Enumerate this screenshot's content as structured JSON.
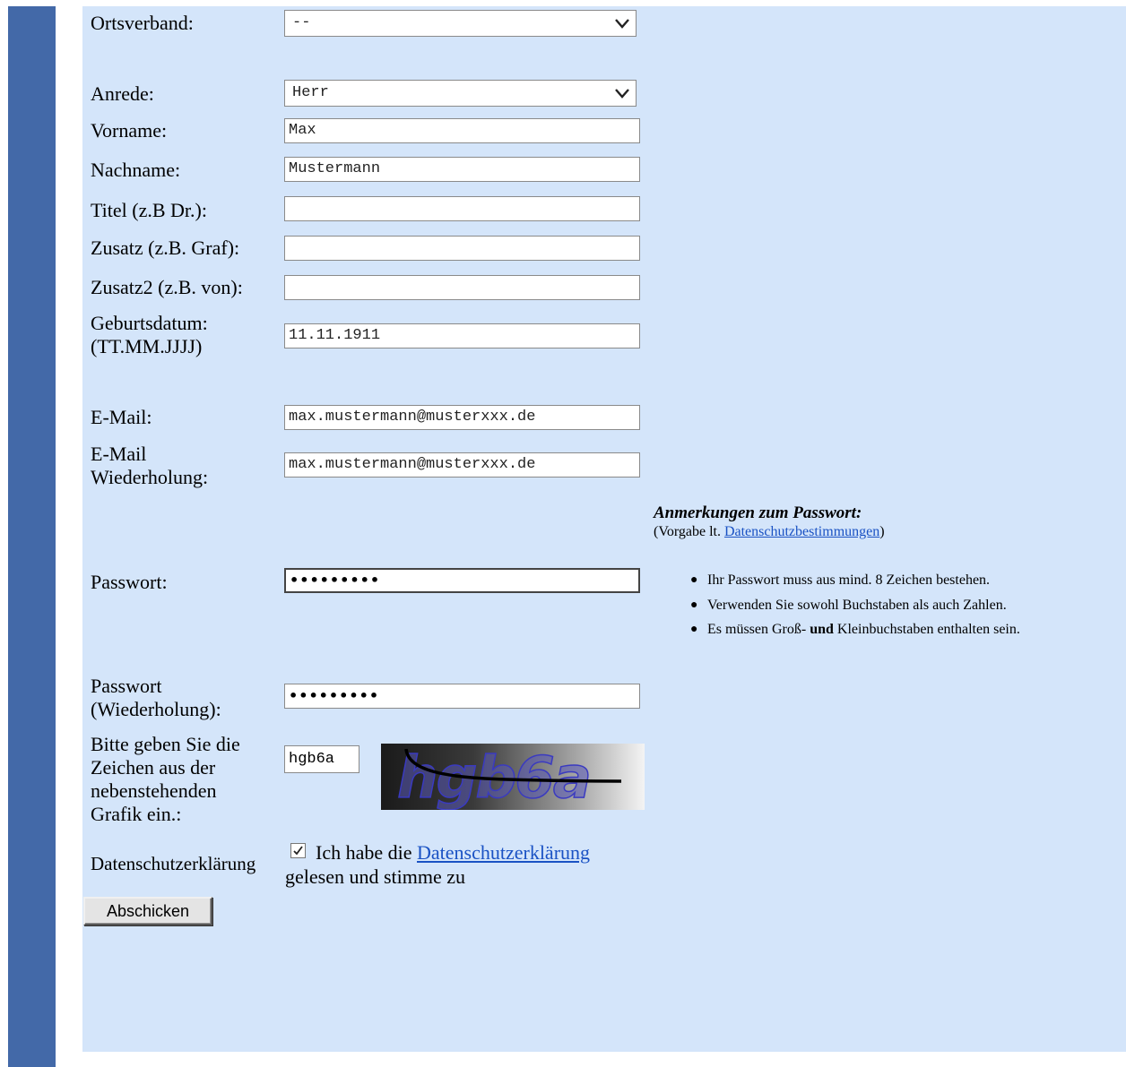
{
  "form": {
    "ortsverband": {
      "label": "Ortsverband:",
      "value": "--"
    },
    "anrede": {
      "label": "Anrede:",
      "value": "Herr"
    },
    "vorname": {
      "label": "Vorname:",
      "value": "Max"
    },
    "nachname": {
      "label": "Nachname:",
      "value": "Mustermann"
    },
    "titel": {
      "label": "Titel (z.B Dr.):",
      "value": ""
    },
    "zusatz": {
      "label": "Zusatz (z.B. Graf):",
      "value": ""
    },
    "zusatz2": {
      "label": "Zusatz2 (z.B. von):",
      "value": ""
    },
    "geburtsdatum": {
      "label_line1": "Geburtsdatum:",
      "label_line2": "(TT.MM.JJJJ)",
      "value": "11.11.1911"
    },
    "email": {
      "label": "E-Mail:",
      "value": "max.mustermann@musterxxx.de"
    },
    "email_repeat": {
      "label_line1": "E-Mail",
      "label_line2": "Wiederholung:",
      "value": "max.mustermann@musterxxx.de"
    },
    "passwort": {
      "label": "Passwort:",
      "masked_value": "•••••••••"
    },
    "passwort_repeat": {
      "label_line1": "Passwort",
      "label_line2": "(Wiederholung):",
      "masked_value": "•••••••••"
    },
    "captcha": {
      "label_lines": [
        "Bitte geben Sie die",
        "Zeichen aus der",
        "nebenstehenden",
        "Grafik ein.:"
      ],
      "value": "hgb6a",
      "image_text": "hgb6a"
    },
    "datenschutz": {
      "label": "Datenschutzerklärung",
      "checked": true,
      "text_before": "Ich habe die",
      "link_text": "Datenschutzerklärung",
      "text_after": "gelesen und stimme zu"
    },
    "submit_label": "Abschicken"
  },
  "password_notes": {
    "title": "Anmerkungen zum Passwort:",
    "sub_before": "(Vorgabe lt. ",
    "sub_link": "Datenschutzbestimmungen",
    "sub_after": ")",
    "rules": {
      "r1": "Ihr Passwort muss aus mind. 8 Zeichen bestehen.",
      "r2": "Verwenden Sie sowohl Buchstaben als auch Zahlen.",
      "r3_before": "Es müssen Groß- ",
      "r3_bold": "und",
      "r3_after": " Kleinbuchstaben enthalten sein."
    }
  },
  "colors": {
    "sidebar": "#4369a8",
    "panel": "#d4e5fa",
    "link": "#1a52c4"
  }
}
